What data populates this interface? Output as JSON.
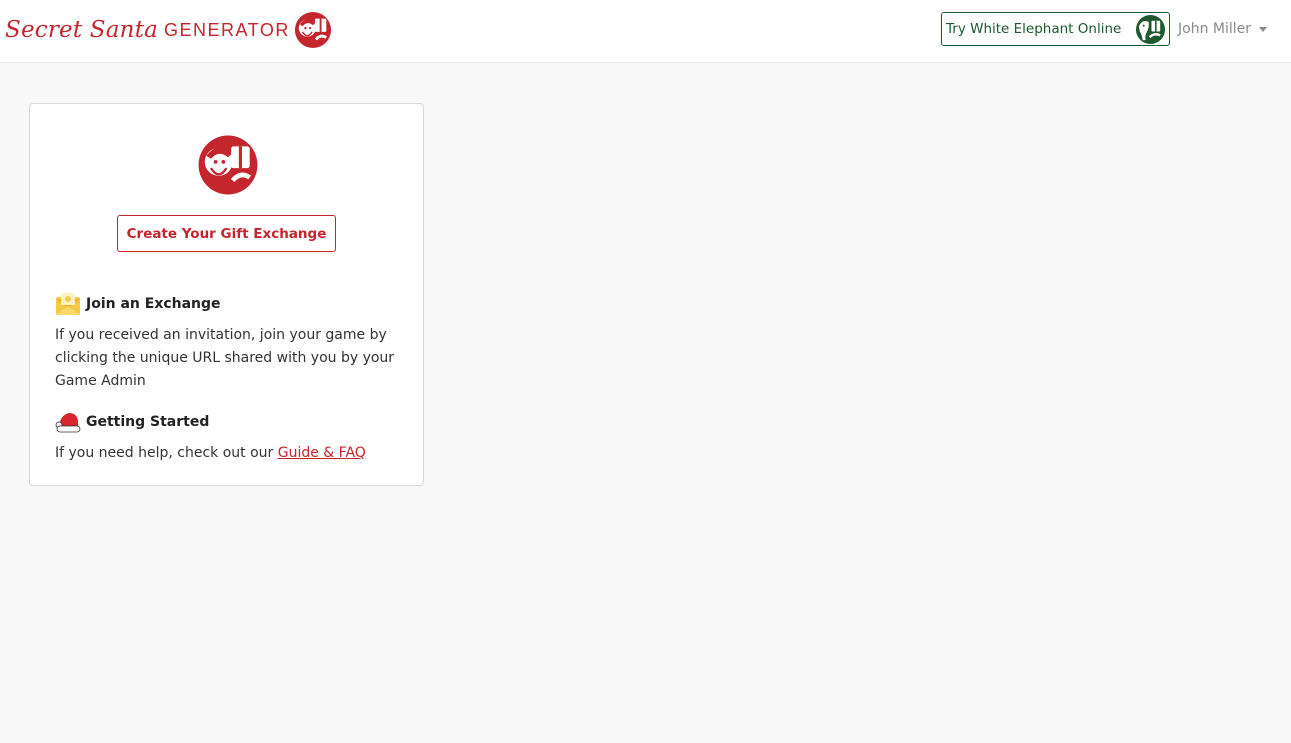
{
  "header": {
    "brand_script": "Secret Santa",
    "brand_caps": "GENERATOR",
    "white_elephant_label": "Try White Elephant Online",
    "white_elephant_icon": "white-elephant-gift-icon",
    "user_name": "John Miller"
  },
  "card": {
    "logo_icon": "santa-gift-icon",
    "create_button": "Create Your Gift Exchange",
    "join": {
      "icon": "envelope-icon",
      "title": "Join an Exchange",
      "body": "If you received an invitation, join your game by clicking the unique URL shared with you by your Game Admin"
    },
    "getting_started": {
      "icon": "santa-hat-icon",
      "title": "Getting Started",
      "body_prefix": "If you need help, check out our ",
      "link": "Guide & FAQ"
    }
  },
  "colors": {
    "brand_red": "#c5252c",
    "elephant_green": "#1e5a2e",
    "page_background": "#f8f8f8"
  }
}
